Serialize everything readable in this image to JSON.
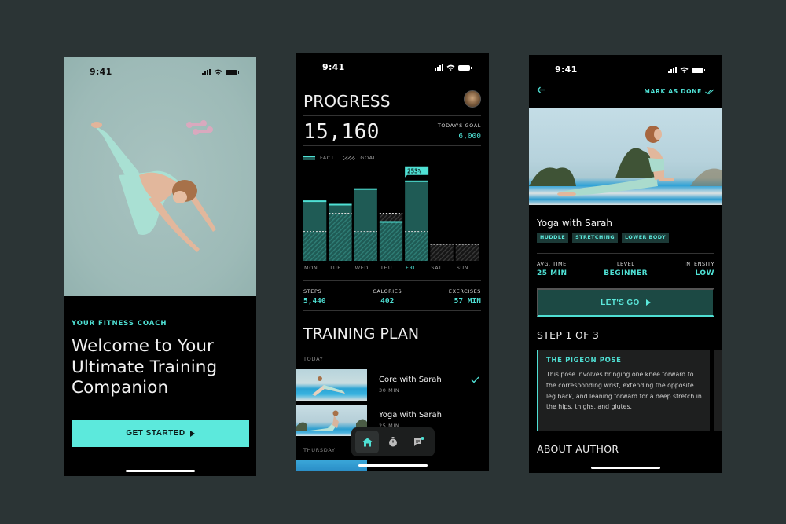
{
  "status_bar": {
    "time": "9:41"
  },
  "welcome_screen": {
    "eyebrow": "YOUR FITNESS COACH",
    "title": "Welcome to Your Ultimate Training Companion",
    "cta_label": "GET STARTED"
  },
  "progress_screen": {
    "title": "PROGRESS",
    "total_steps": "15,160",
    "goal_label": "TODAY'S GOAL",
    "goal_value": "6,000",
    "legend": {
      "fact": "FACT",
      "goal": "GOAL"
    },
    "stats": [
      {
        "label": "STEPS",
        "value": "5,440"
      },
      {
        "label": "CALORIES",
        "value": "402"
      },
      {
        "label": "EXERCISES",
        "value": "57 MIN"
      }
    ],
    "training_plan_title": "TRAINING PLAN",
    "sections": [
      {
        "label": "TODAY",
        "workouts": [
          {
            "title": "Core with Sarah",
            "duration": "30 MIN",
            "done": true
          },
          {
            "title": "Yoga with Sarah",
            "duration": "25 MIN",
            "done": false
          }
        ]
      },
      {
        "label": "THURSDAY",
        "workouts": []
      }
    ],
    "nav": [
      {
        "name": "home",
        "active": true
      },
      {
        "name": "timer",
        "active": false
      },
      {
        "name": "chat",
        "active": false,
        "badge": true
      }
    ]
  },
  "chart_data": {
    "type": "bar",
    "title": "",
    "categories": [
      "MON",
      "TUE",
      "WED",
      "THU",
      "FRI",
      "SAT",
      "SUN"
    ],
    "highlight_category": "FRI",
    "series": [
      {
        "name": "FACT",
        "values": [
          69,
          65,
          83,
          45,
          92,
          0,
          0
        ]
      },
      {
        "name": "GOAL",
        "values": [
          34,
          55,
          34,
          55,
          34,
          19,
          19
        ]
      }
    ],
    "annotations": [
      {
        "category": "FRI",
        "text": "253%"
      }
    ],
    "ylim": [
      0,
      100
    ],
    "xlabel": "",
    "ylabel": "",
    "grid": false,
    "legend": "top-left"
  },
  "detail_screen": {
    "mark_done_label": "MARK AS DONE",
    "title": "Yoga with Sarah",
    "tags": [
      "HUDDLE",
      "STRETCHING",
      "LOWER BODY"
    ],
    "meta": [
      {
        "label": "AVG. TIME",
        "value": "25 MIN"
      },
      {
        "label": "LEVEL",
        "value": "BEGINNER"
      },
      {
        "label": "INTENSITY",
        "value": "LOW"
      }
    ],
    "cta_label": "LET'S GO",
    "step_title": "STEP 1 OF 3",
    "step": {
      "heading": "THE PIGEON POSE",
      "body": "This pose involves bringing one knee forward to the corresponding wrist, extending the opposite leg back, and leaning forward for a deep stretch in the hips, thighs, and glutes."
    },
    "about_title": "ABOUT AUTHOR"
  },
  "colors": {
    "accent": "#4fe0d4",
    "accent_button": "#5ce9dc",
    "bar_fill": "#1f5b55",
    "background": "#2b3435",
    "screen": "#000000"
  }
}
